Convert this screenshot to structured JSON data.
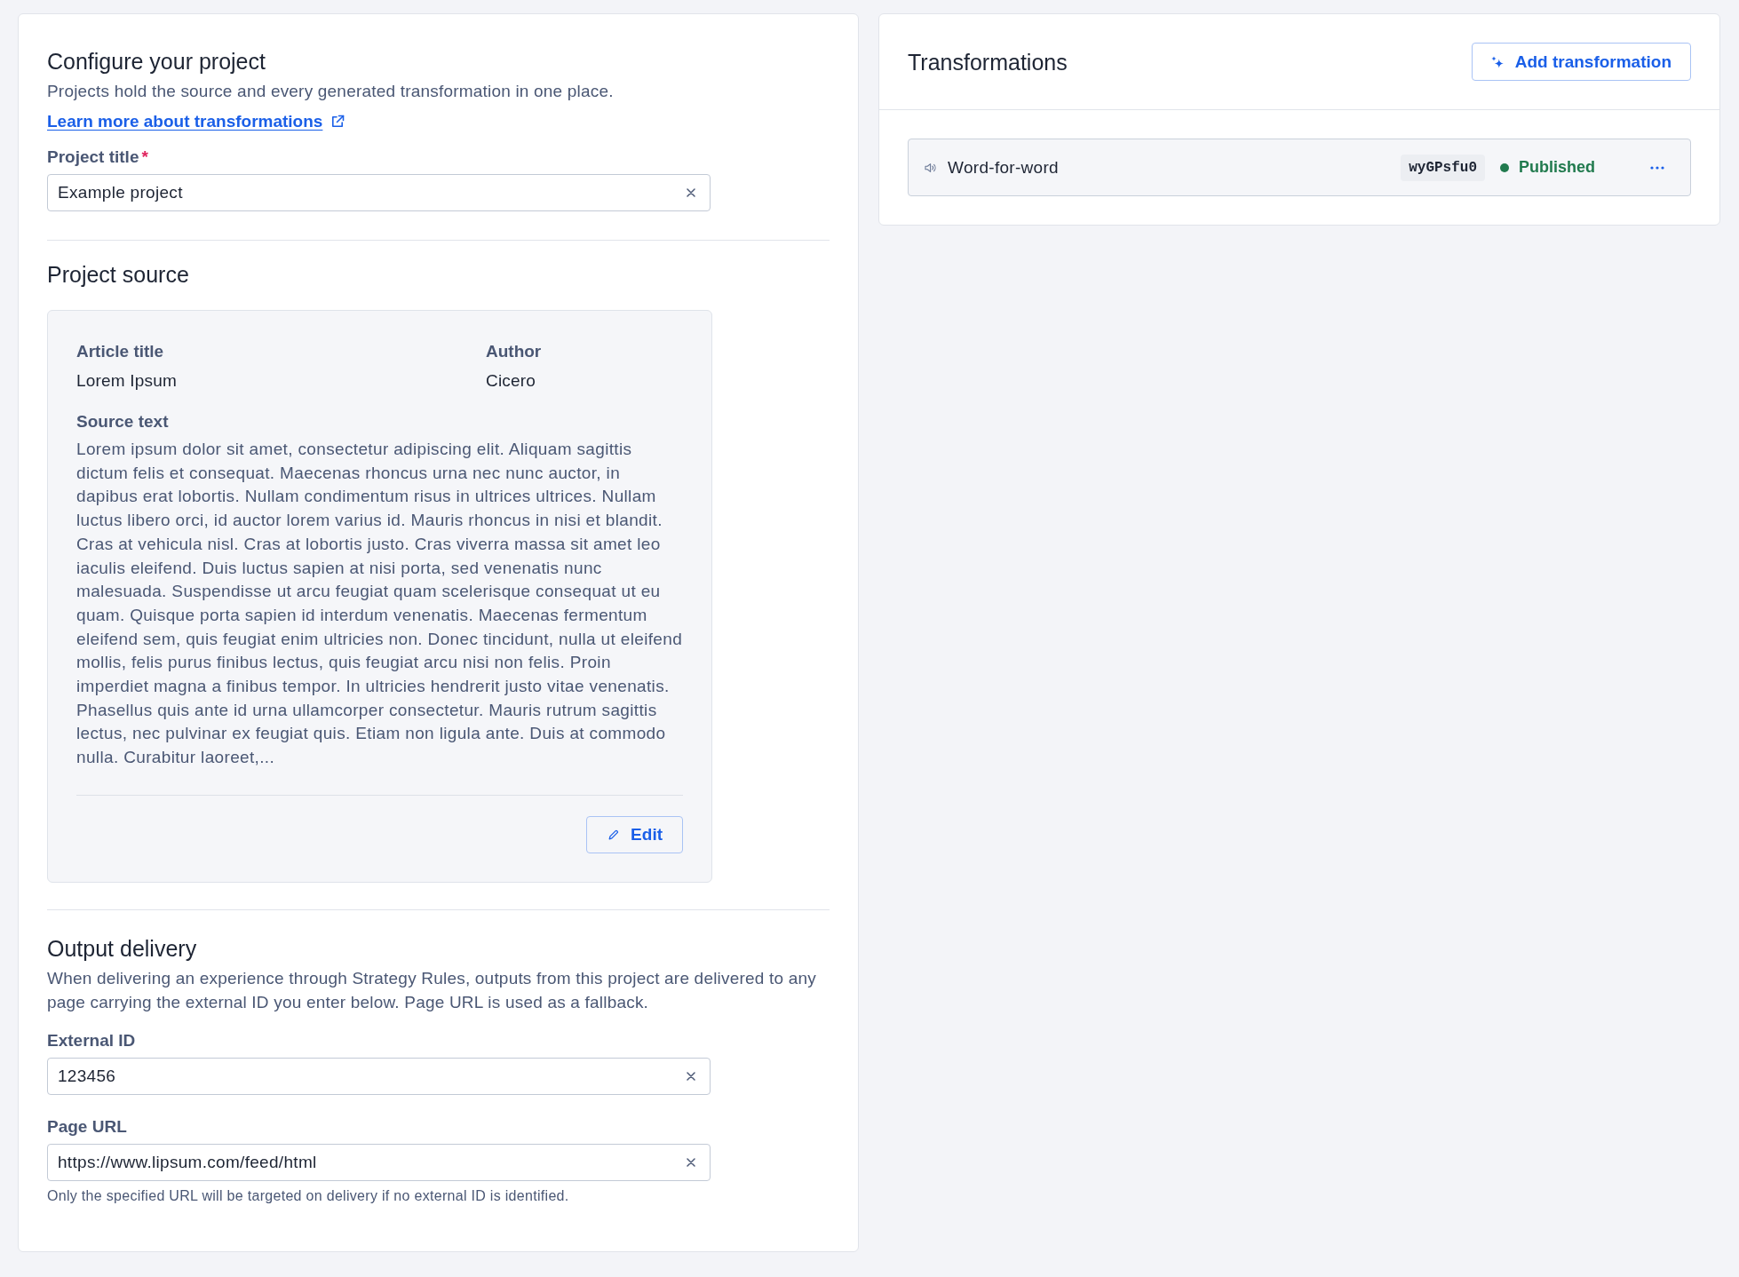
{
  "configure": {
    "title": "Configure your project",
    "description": "Projects hold the source and every generated transformation in one place.",
    "link": "Learn more about transformations",
    "fields": [
      {
        "label": "Project title",
        "required_mark": "*",
        "value": "Example project"
      }
    ]
  },
  "project_source": {
    "title": "Project source",
    "details": [
      {
        "label": "Article title",
        "value": "Lorem Ipsum"
      },
      {
        "label": "Author",
        "value": "Cicero"
      }
    ],
    "source_text": {
      "label": "Source text",
      "value": "Lorem ipsum dolor sit amet, consectetur adipiscing elit. Aliquam sagittis dictum felis et consequat. Maecenas rhoncus urna nec nunc auctor, in dapibus erat lobortis. Nullam condimentum risus in ultrices ultrices. Nullam luctus libero orci, id auctor lorem varius id. Mauris rhoncus in nisi et blandit. Cras at vehicula nisl. Cras at lobortis justo. Cras viverra massa sit amet leo iaculis eleifend. Duis luctus sapien at nisi porta, sed venenatis nunc malesuada. Suspendisse ut arcu feugiat quam scelerisque consequat ut eu quam. Quisque porta sapien id interdum venenatis. Maecenas fermentum eleifend sem, quis feugiat enim ultricies non. Donec tincidunt, nulla ut eleifend mollis, felis purus finibus lectus, quis feugiat arcu nisi non felis. Proin imperdiet magna a finibus tempor. In ultricies hendrerit justo vitae venenatis. Phasellus quis ante id urna ullamcorper consectetur. Mauris rutrum sagittis lectus, nec pulvinar ex feugiat quis. Etiam non ligula ante. Duis at commodo nulla. Curabitur laoreet,..."
    },
    "edit_button": "Edit"
  },
  "output_delivery": {
    "title": "Output delivery",
    "description": "When delivering an experience through Strategy Rules, outputs from this project are delivered to any page carrying the external ID you enter below. Page URL is used as a fallback.",
    "fields": [
      {
        "label": "External ID",
        "value": "123456"
      },
      {
        "label": "Page URL",
        "value": "https://www.lipsum.com/feed/html",
        "help": "Only the specified URL will be targeted on delivery if no external ID is identified."
      }
    ]
  },
  "transformations": {
    "title": "Transformations",
    "add_button": "Add transformation",
    "items": [
      {
        "name": "Word-for-word",
        "code": "wyGPsfu0",
        "status": "Published",
        "color": "#217a4e"
      }
    ]
  }
}
